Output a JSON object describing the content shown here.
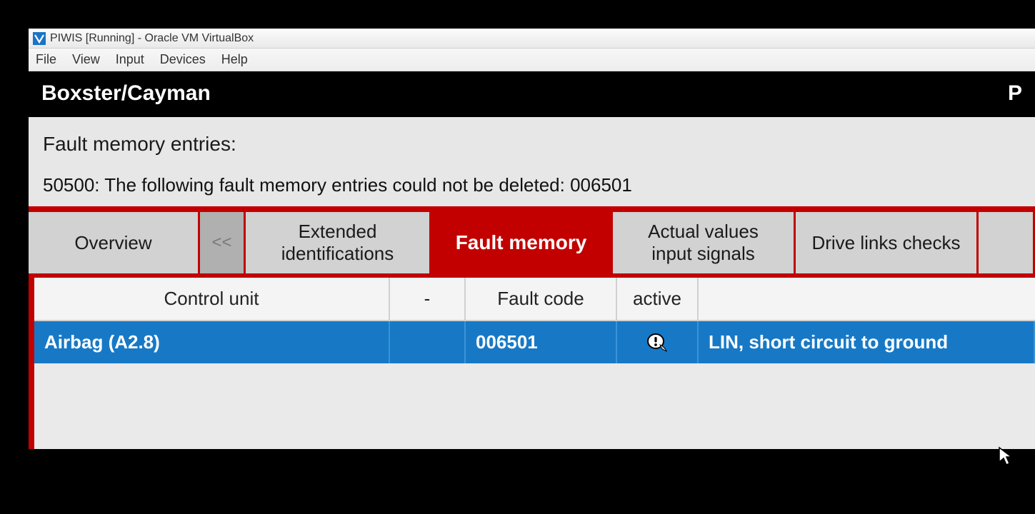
{
  "window": {
    "title": "PIWIS [Running] - Oracle VM VirtualBox"
  },
  "menubar": {
    "file": "File",
    "view": "View",
    "input": "Input",
    "devices": "Devices",
    "help": "Help"
  },
  "header": {
    "vehicle": "Boxster/Cayman",
    "right": "P"
  },
  "panel": {
    "label": "Fault memory entries:",
    "message": "50500: The following fault memory entries could not be deleted: 006501"
  },
  "tabs": {
    "overview": "Overview",
    "scroll_left": "<<",
    "extended": "Extended identifications",
    "fault_memory": "Fault memory",
    "actual_values": "Actual values input signals",
    "drive_links": "Drive links checks"
  },
  "table": {
    "columns": {
      "control_unit": "Control unit",
      "dash": "-",
      "fault_code": "Fault code",
      "active": "active",
      "description": ""
    },
    "rows": [
      {
        "control_unit": "Airbag (A2.8)",
        "dash": "",
        "fault_code": "006501",
        "active_icon": "warning-icon",
        "description": "LIN, short circuit to ground"
      }
    ]
  }
}
